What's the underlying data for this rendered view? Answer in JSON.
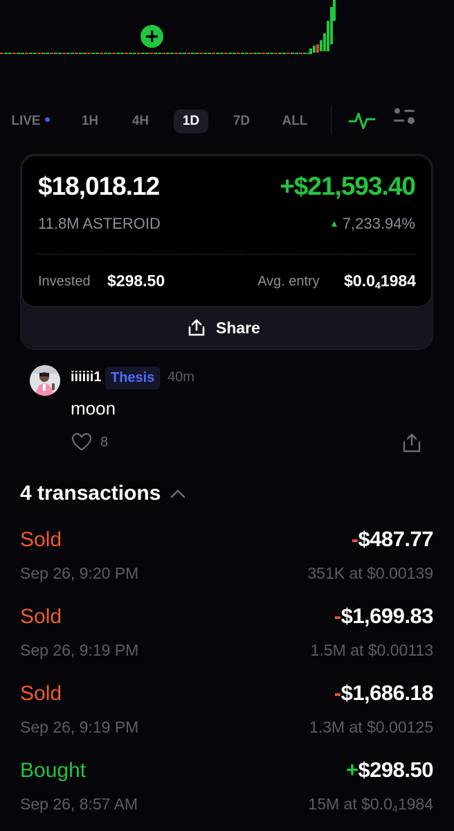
{
  "chart": {
    "up_color": "#22c53e",
    "down_color": "#e0413a",
    "add_button_icon": "plus-circle-icon"
  },
  "timeframes": {
    "items": [
      "LIVE",
      "1H",
      "4H",
      "1D",
      "7D",
      "ALL"
    ],
    "active": "1D",
    "live_indicator_color": "#3b5bff",
    "chart_mode_icon": "pulse-line-icon",
    "settings_icon": "sliders-icon"
  },
  "position": {
    "value": "$18,018.12",
    "pnl": "+$21,593.40",
    "holding": "11.8M ASTEROID",
    "pnl_percent": "7,233.94%",
    "invested_label": "Invested",
    "invested_value": "$298.50",
    "avg_entry_label": "Avg. entry",
    "avg_entry_prefix": "$0.0",
    "avg_entry_zeros": "4",
    "avg_entry_digits": "1984",
    "share_label": "Share"
  },
  "post": {
    "username": "iiiiii1",
    "badge": "Thesis",
    "time_ago": "40m",
    "text": "moon",
    "likes": "8"
  },
  "transactions": {
    "header": "4 transactions",
    "items": [
      {
        "type": "Sold",
        "sign": "-",
        "amount": "$487.77",
        "date": "Sep 26, 9:20 PM",
        "qty": "351K",
        "at": "at",
        "price": "$0.00139"
      },
      {
        "type": "Sold",
        "sign": "-",
        "amount": "$1,699.83",
        "date": "Sep 26, 9:19 PM",
        "qty": "1.5M",
        "at": "at",
        "price": "$0.00113"
      },
      {
        "type": "Sold",
        "sign": "-",
        "amount": "$1,686.18",
        "date": "Sep 26, 9:19 PM",
        "qty": "1.3M",
        "at": "at",
        "price": "$0.00125"
      },
      {
        "type": "Bought",
        "sign": "+",
        "amount": "$298.50",
        "date": "Sep 26, 8:57 AM",
        "qty": "15M",
        "at": "at",
        "price_prefix": "$0.0",
        "price_zeros": "4",
        "price_digits": "1984"
      }
    ]
  }
}
